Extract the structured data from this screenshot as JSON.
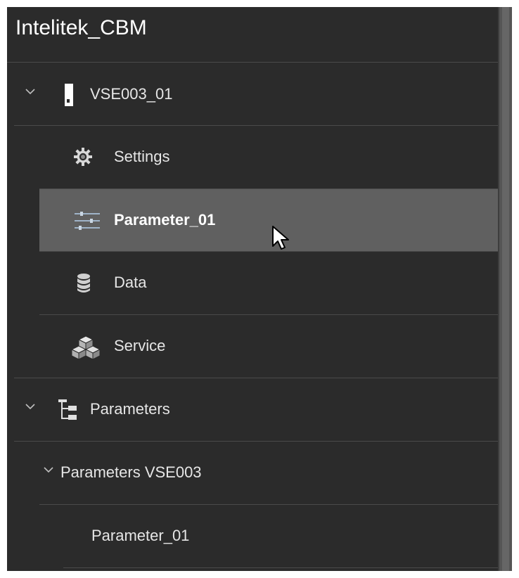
{
  "app": {
    "title": "Intelitek_CBM"
  },
  "tree": {
    "device": {
      "label": "VSE003_01",
      "expanded": true,
      "icon": "device-icon"
    },
    "children": [
      {
        "label": "Settings",
        "icon": "gear-icon"
      },
      {
        "label": "Parameter_01",
        "icon": "sliders-icon",
        "selected": true
      },
      {
        "label": "Data",
        "icon": "database-icon"
      },
      {
        "label": "Service",
        "icon": "cubes-icon"
      }
    ],
    "parameters": {
      "label": "Parameters",
      "expanded": true,
      "icon": "hierarchy-icon",
      "group": {
        "label": "Parameters VSE003",
        "expanded": true,
        "items": [
          {
            "label": "Parameter_01"
          }
        ]
      }
    }
  },
  "colors": {
    "panel_bg": "#2b2b2b",
    "selected_bg": "#606060",
    "divider": "#4a4a4a",
    "text": "#e6e6e6"
  }
}
